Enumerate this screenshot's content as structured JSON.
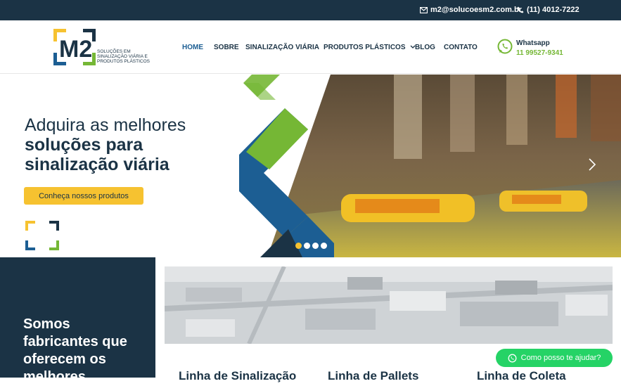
{
  "topbar": {
    "email": "m2@solucoesm2.com.br",
    "phone": "(11) 4012-7222"
  },
  "brand": {
    "logo_text": "M2",
    "tagline": "SOLUÇÕES EM SINALIZAÇÃO VIÁRIA E PRODUTOS PLÁSTICOS"
  },
  "nav": {
    "items": [
      {
        "label": "HOME"
      },
      {
        "label": "SOBRE"
      },
      {
        "label": "SINALIZAÇÃO VIÁRIA"
      },
      {
        "label": "PRODUTOS PLÁSTICOS"
      },
      {
        "label": "BLOG"
      },
      {
        "label": "CONTATO"
      }
    ]
  },
  "whatsapp": {
    "title": "Whatsapp",
    "number": "11 99527-9341"
  },
  "hero": {
    "line1": "Adquira as melhores",
    "line2": "soluções para",
    "line3": "sinalização viária",
    "button": "Conheça nossos produtos",
    "slides": 4,
    "active_slide": 1
  },
  "about": {
    "heading": "Somos fabricantes que oferecem os melhores"
  },
  "product_lines": [
    {
      "label": "Linha de Sinalização"
    },
    {
      "label": "Linha de Pallets"
    },
    {
      "label": "Linha de Coleta"
    }
  ],
  "chat": {
    "label": "Como posso te ajudar?"
  },
  "colors": {
    "navy": "#1b3345",
    "blue": "#1c5e93",
    "green": "#75b735",
    "yellow": "#f6c230",
    "whatsapp": "#25d366"
  }
}
